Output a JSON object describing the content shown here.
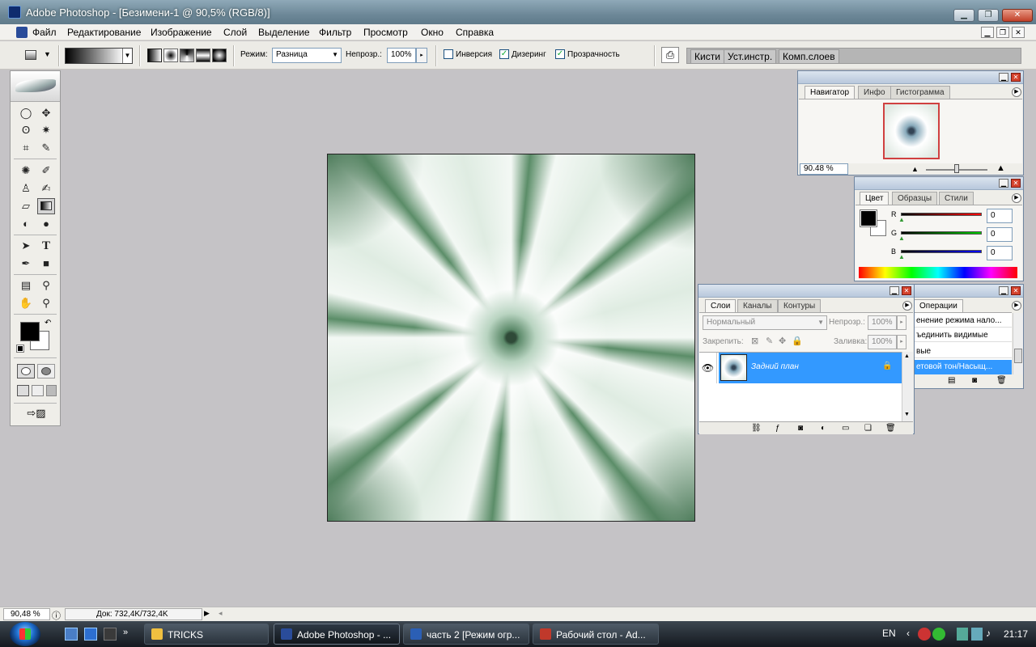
{
  "titlebar": {
    "title": "Adobe Photoshop - [Безимени-1 @ 90,5% (RGB/8)]"
  },
  "menu": [
    "Файл",
    "Редактирование",
    "Изображение",
    "Слой",
    "Выделение",
    "Фильтр",
    "Просмотр",
    "Окно",
    "Справка"
  ],
  "options": {
    "mode_label": "Режим:",
    "mode_value": "Разница",
    "opacity_label": "Непрозр.:",
    "opacity_value": "100%",
    "inverse_label": "Инверсия",
    "dither_label": "Дизеринг",
    "transparency_label": "Прозрачность",
    "inverse_checked": false,
    "dither_checked": true,
    "transparency_checked": true
  },
  "palette_well": [
    "Кисти",
    "Уст.инстр.",
    "Комп.слоев"
  ],
  "navigator": {
    "tabs": [
      "Навигатор",
      "Инфо",
      "Гистограмма"
    ],
    "zoom": "90.48 %"
  },
  "color": {
    "tabs": [
      "Цвет",
      "Образцы",
      "Стили"
    ],
    "r_label": "R",
    "r_value": "0",
    "g_label": "G",
    "g_value": "0",
    "b_label": "B",
    "b_value": "0"
  },
  "history": {
    "tab": "Операции",
    "items": [
      "енение режима нало...",
      "ъединить видимые",
      "вые",
      "етовой тон/Насыщ..."
    ]
  },
  "layers": {
    "tabs": [
      "Слои",
      "Каналы",
      "Контуры"
    ],
    "blend_mode": "Нормальный",
    "opacity_label": "Непрозр.:",
    "opacity_value": "100%",
    "lock_label": "Закрепить:",
    "fill_label": "Заливка:",
    "fill_value": "100%",
    "layer_name": "Задний план"
  },
  "status": {
    "zoom": "90,48 %",
    "doc": "Док: 732,4K/732,4K"
  },
  "taskbar": {
    "items": [
      "TRICKS",
      "Adobe Photoshop - ...",
      "часть 2 [Режим огр...",
      "Рабочий стол - Ad..."
    ],
    "lang": "EN",
    "clock": "21:17"
  },
  "colors": {
    "selection": "#3399ff",
    "accent_red": "#c0392b"
  }
}
